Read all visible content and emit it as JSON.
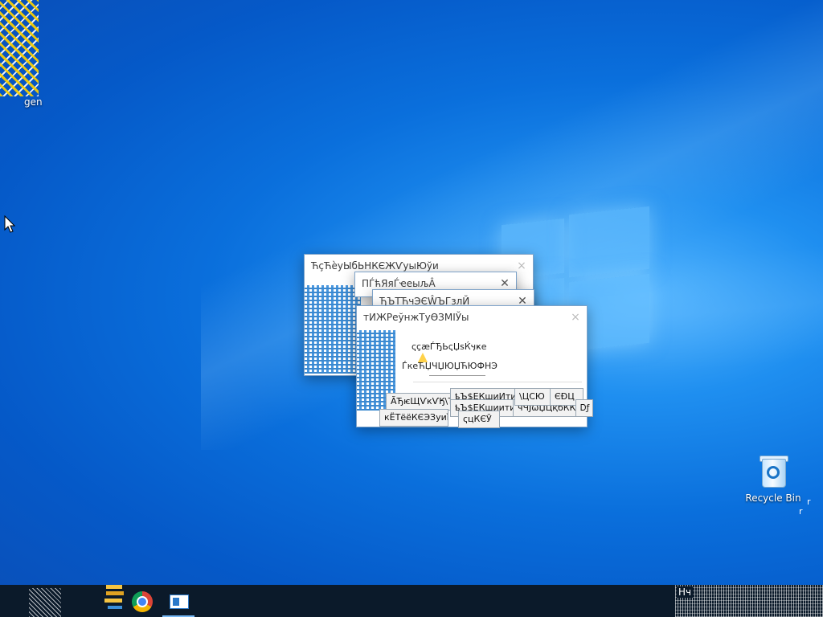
{
  "desktop": {
    "icons": [
      {
        "label": "gen",
        "icon": "keygen-icon"
      },
      {
        "label": "Recycle Bin",
        "icon": "recycle-bin-icon"
      }
    ],
    "stray_text": [
      "r",
      "r"
    ]
  },
  "dialogs": [
    {
      "title": "ЋçЋѐуЫбЬНКЄЖѴуыЮўи",
      "close_icon": "close-icon"
    },
    {
      "title": "ПЃћЯяЃҽеыљÂ",
      "close_icon": "close-icon",
      "close_glyph": "✕"
    },
    {
      "title": "ЂЪТЋчЭЄŴЪГзлЙ",
      "close_icon": "close-icon",
      "close_glyph": "✕"
    },
    {
      "title": "тИЖРеўнжТуѲЗМІЎы",
      "close_icon": "close-icon",
      "close_glyph": "×",
      "lines": [
        "ҁҫӕЃЂЬҁЏѕЌӌҝе",
        "ЃкеЋЏЧЏЮЏЋЮФНЭ"
      ],
      "buttons": [
        "ÃЂѥЩѴкѴӃ\\ЪЇѥ",
        "ҍЪ$ЕКшиИтиҥЪ",
        "ҍЪ$ЕКшиитиҥЪ",
        "чЧЈѡЏЦқбКЌчуЈ",
        "кЁТёёКЄЭЗуиì",
        "\\ЦСЮ",
        "ЄÐЦ",
        "ҁцКЄӮ",
        "Ꭰƒ"
      ]
    }
  ],
  "taskbar": {
    "start_icon": "start-icon",
    "pinned": [
      {
        "name": "file-explorer-icon"
      },
      {
        "name": "chrome-icon"
      },
      {
        "name": "app-window-icon",
        "active": true
      }
    ],
    "tray_text": "Нч"
  }
}
